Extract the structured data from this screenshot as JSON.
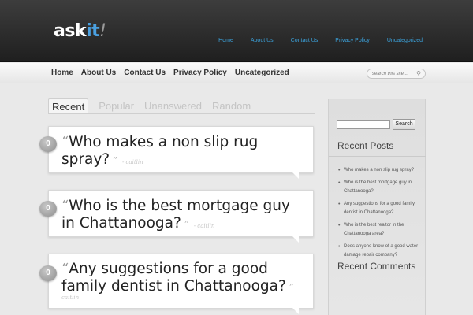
{
  "logo": {
    "main": "ask",
    "accent": "it",
    "mark": "!"
  },
  "top_nav": [
    "Home",
    "About Us",
    "Contact Us",
    "Privacy Policy",
    "Uncategorized"
  ],
  "sub_nav": [
    "Home",
    "About Us",
    "Contact Us",
    "Privacy Policy",
    "Uncategorized"
  ],
  "site_search": {
    "placeholder": "search this site..."
  },
  "tabs": [
    "Recent",
    "Popular",
    "Unanswered",
    "Random"
  ],
  "questions": [
    {
      "answers": "0",
      "title": "Who makes a non slip rug spray?",
      "author": "- caitlin"
    },
    {
      "answers": "0",
      "title": "Who is the best mortgage guy in Chattanooga?",
      "author": "- caitlin"
    },
    {
      "answers": "0",
      "title": "Any suggestions for a good family dentist in Chattanooga?",
      "author": "caitlin"
    }
  ],
  "sidebar": {
    "search_button": "Search",
    "recent_posts_heading": "Recent Posts",
    "recent_posts": [
      "Who makes a non slip rug spray?",
      "Who is the best mortgage guy in Chattanooga?",
      "Any suggestions for a good family dentist in Chattanooga?",
      "Who is the best realtor in the Chattanooga area?",
      "Does anyone know of a good water damage repair company?"
    ],
    "recent_comments_heading": "Recent Comments"
  },
  "colors": {
    "accent": "#3ba3dd",
    "header_bg": "#2a2a2a",
    "page_bg": "#e9e9e9"
  },
  "icons": {
    "search": "magnifier-icon",
    "answers": "speech-bubble-icon"
  }
}
